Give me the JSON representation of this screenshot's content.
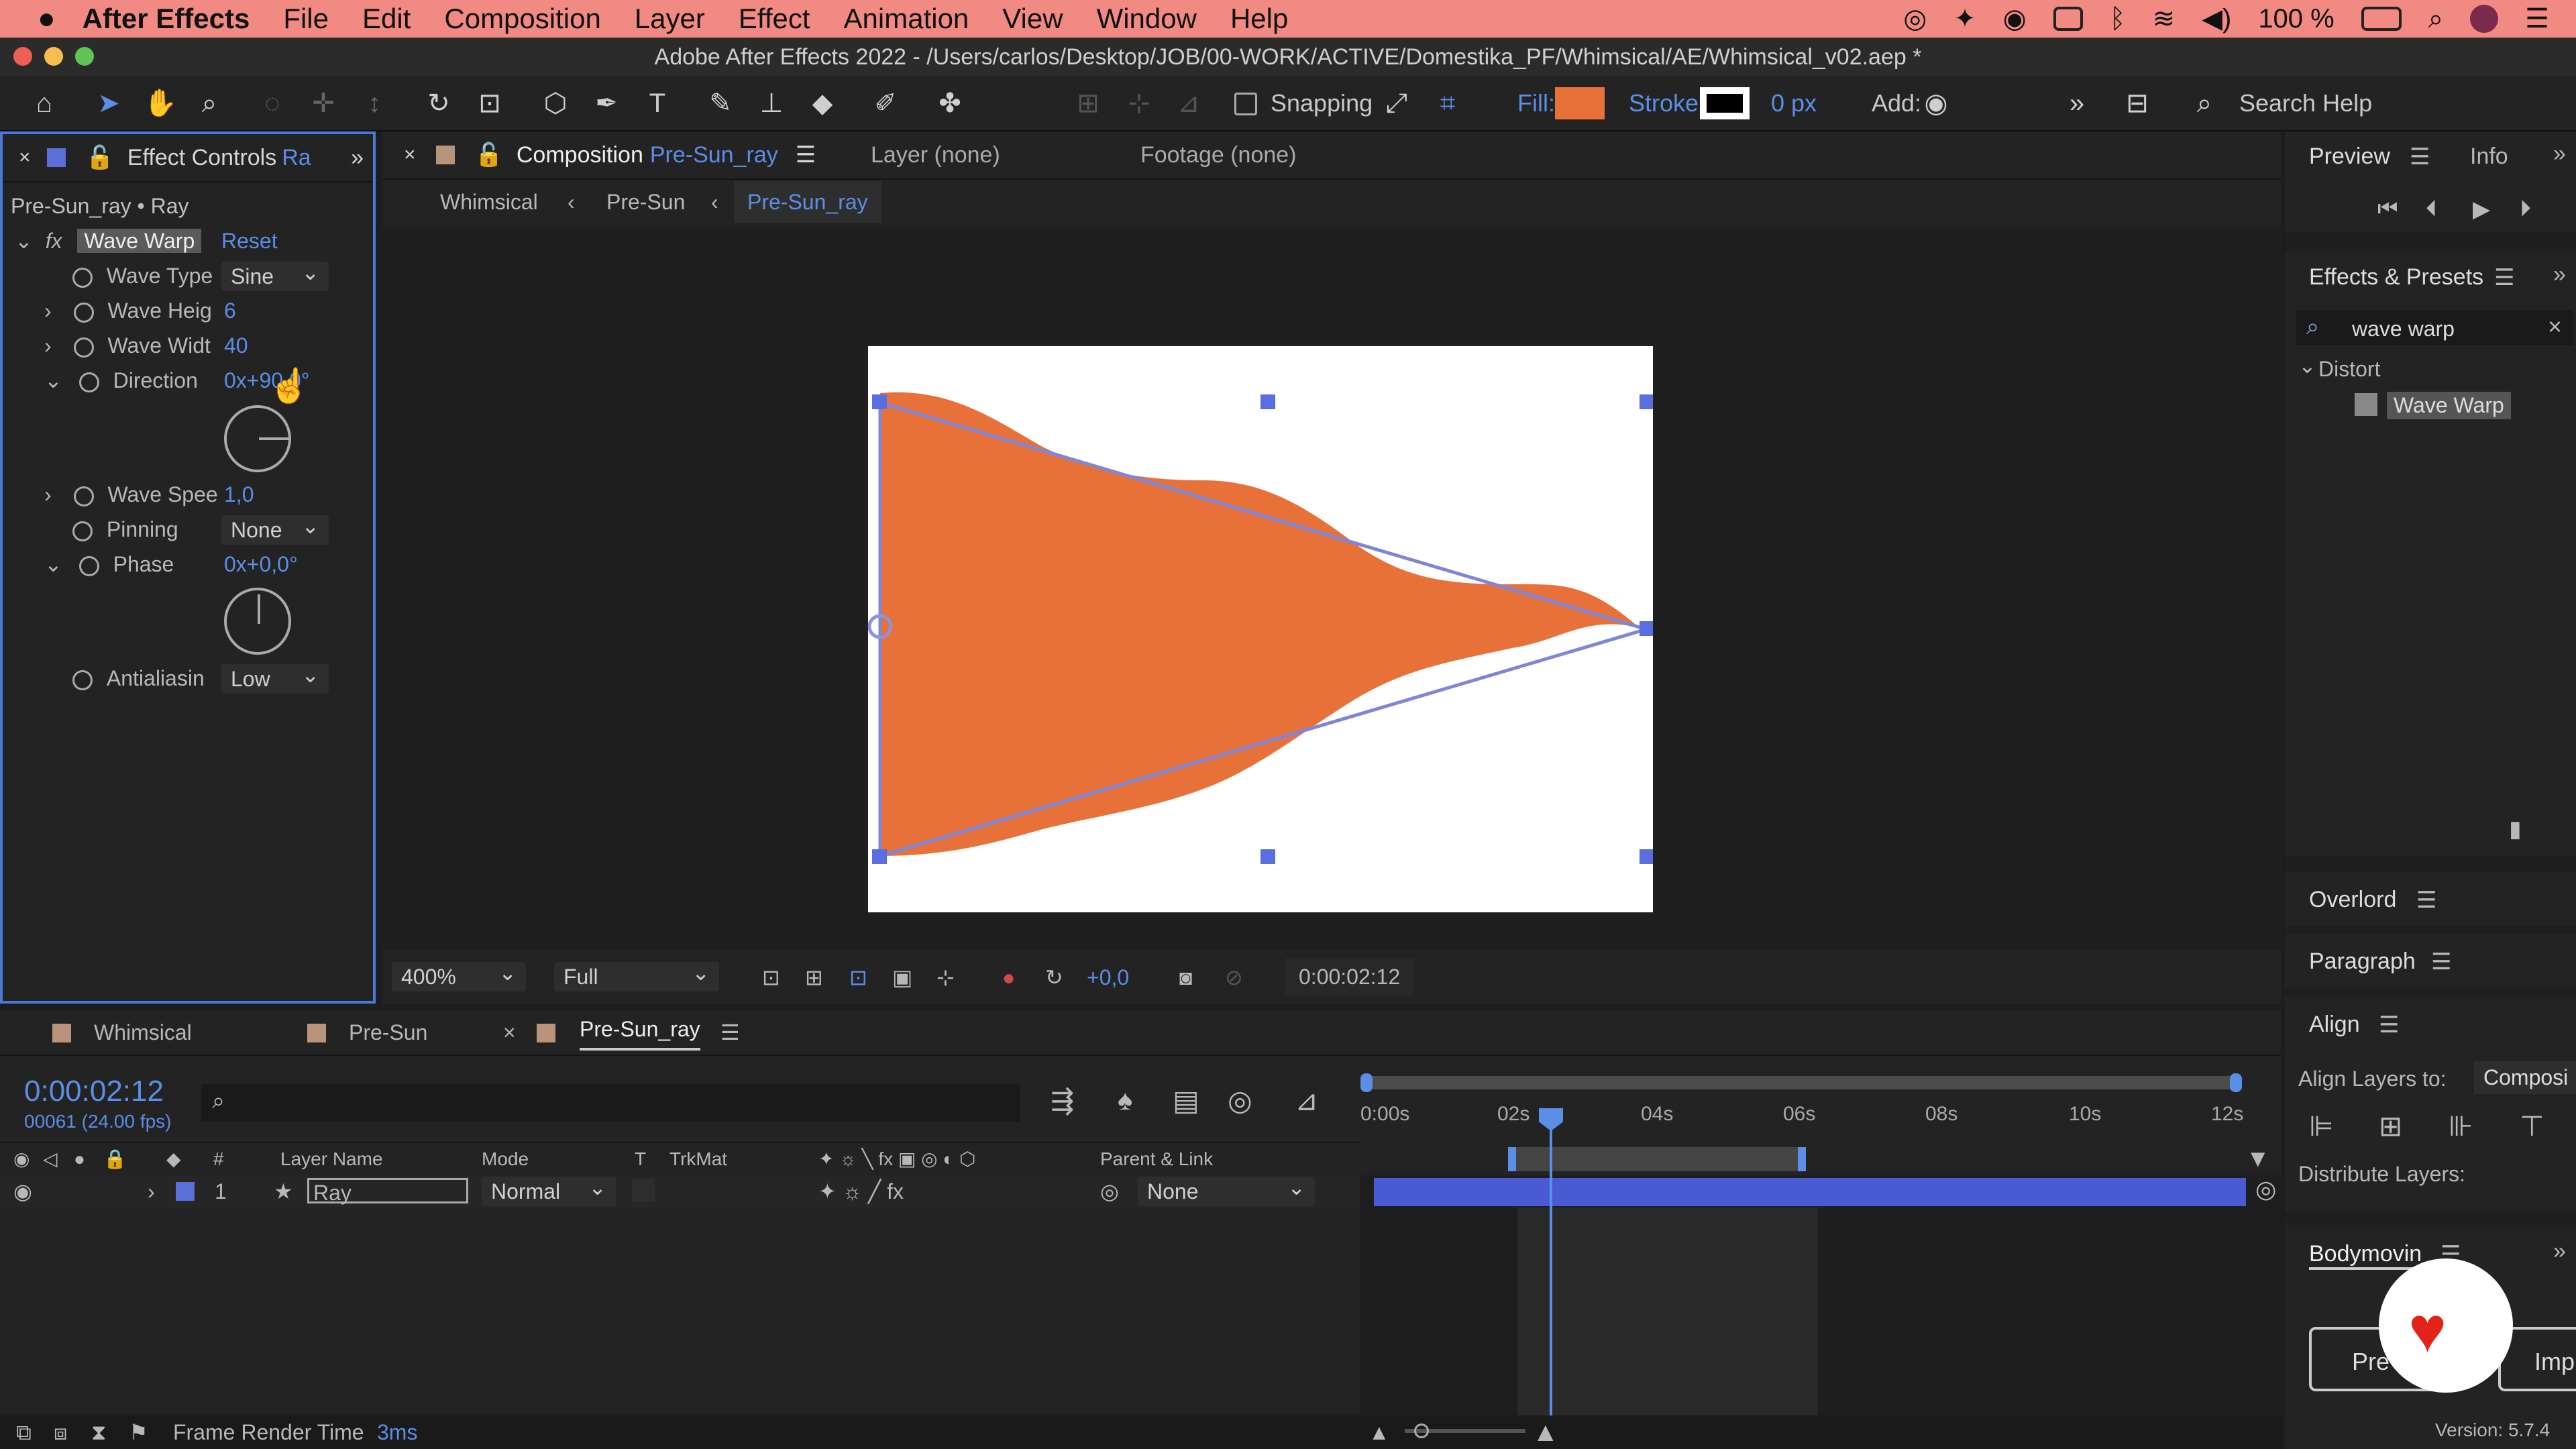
{
  "menubar": {
    "app": "After Effects",
    "items": [
      "File",
      "Edit",
      "Composition",
      "Layer",
      "Effect",
      "Animation",
      "View",
      "Window",
      "Help"
    ],
    "battery": "100 %"
  },
  "titlebar": {
    "title": "Adobe After Effects 2022 - /Users/carlos/Desktop/JOB/00-WORK/ACTIVE/Domestika_PF/Whimsical/AE/Whimsical_v02.aep *"
  },
  "toolbar": {
    "snapping": "Snapping",
    "fill_label": "Fill:",
    "stroke_label": "Stroke:",
    "stroke_px": "0 px",
    "add_label": "Add:",
    "search_placeholder": "Search Help",
    "fill_color": "#e8713a"
  },
  "effect_controls": {
    "tab_label": "Effect Controls",
    "tab_target": "Ra",
    "breadcrumb": "Pre-Sun_ray • Ray",
    "effect_name": "Wave Warp",
    "reset": "Reset",
    "props": {
      "wave_type": {
        "label": "Wave Type",
        "value": "Sine"
      },
      "wave_height": {
        "label": "Wave Heig",
        "value": "6"
      },
      "wave_width": {
        "label": "Wave Widt",
        "value": "40"
      },
      "direction": {
        "label": "Direction",
        "value": "0x+90,0°"
      },
      "wave_speed": {
        "label": "Wave Spee",
        "value": "1,0"
      },
      "pinning": {
        "label": "Pinning",
        "value": "None"
      },
      "phase": {
        "label": "Phase",
        "value": "0x+0,0°"
      },
      "antialiasing": {
        "label": "Antialiasin",
        "value": "Low"
      }
    }
  },
  "composition": {
    "tab_label": "Composition",
    "tab_name": "Pre-Sun_ray",
    "layer_tab": "Layer (none)",
    "footage_tab": "Footage (none)",
    "crumbs": [
      "Whimsical",
      "Pre-Sun",
      "Pre-Sun_ray"
    ],
    "zoom": "400%",
    "resolution": "Full",
    "exposure": "+0,0",
    "timecode": "0:00:02:12",
    "shape_color": "#e8713a"
  },
  "right": {
    "preview": "Preview",
    "info": "Info",
    "effects_presets": "Effects & Presets",
    "search_value": "wave warp",
    "category": "Distort",
    "result": "Wave Warp",
    "overlord": "Overlord",
    "paragraph": "Paragraph",
    "align": "Align",
    "align_layers_to": "Align Layers to:",
    "align_target": "Composi",
    "distribute": "Distribute Layers:",
    "bodymovin": "Bodymovin",
    "btn_pre": "Pre",
    "btn_imp": "Imp",
    "version": "Version: 5.7.4"
  },
  "timeline": {
    "tabs": [
      "Whimsical",
      "Pre-Sun",
      "Pre-Sun_ray"
    ],
    "timecode": "0:00:02:12",
    "frame_info": "00061 (24.00 fps)",
    "columns": {
      "num": "#",
      "name": "Layer Name",
      "mode": "Mode",
      "t": "T",
      "trkmat": "TrkMat",
      "parent": "Parent & Link"
    },
    "ruler": [
      "0:00s",
      "02s",
      "04s",
      "06s",
      "08s",
      "10s",
      "12s"
    ],
    "layer": {
      "index": "1",
      "name": "Ray",
      "mode": "Normal",
      "parent": "None"
    }
  },
  "status": {
    "label": "Frame Render Time",
    "value": "3ms"
  }
}
